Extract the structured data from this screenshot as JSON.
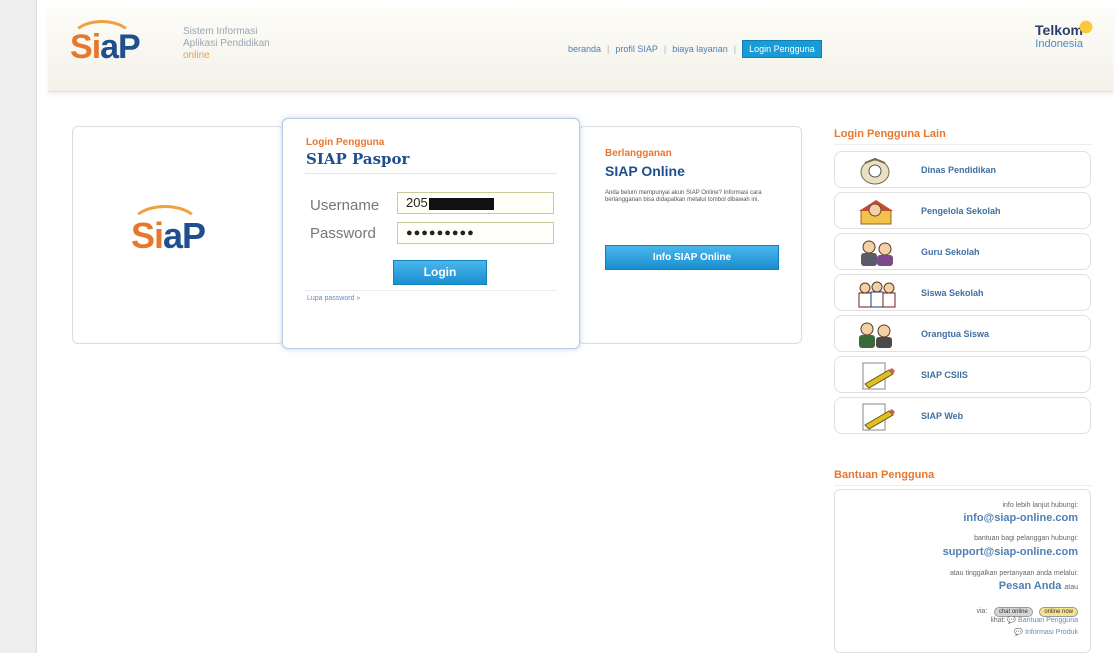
{
  "header": {
    "tagline": [
      "Sistem Informasi",
      "Aplikasi Pendidikan",
      "online"
    ],
    "nav": [
      "beranda",
      "profil SIAP",
      "biaya layanan",
      "Login Pengguna"
    ],
    "brand_name": "Telkom",
    "brand_sub": "Indonesia"
  },
  "logo": {
    "s": "S",
    "i": "i",
    "ap": "aP"
  },
  "login": {
    "small_title": "Login Pengguna",
    "big_title": "SIAP Paspor",
    "username_label": "Username",
    "username_value": "205",
    "password_label": "Password",
    "password_value": "●●●●●●●●●",
    "button": "Login",
    "forgot": "Lupa password »"
  },
  "online": {
    "small_title": "Berlangganan",
    "big_title": "SIAP Online",
    "description": "Anda belum mempunyai akun SIAP Online? Informasi cara berlangganan bisa didapatkan melalui tombol dibawah ini.",
    "button": "Info SIAP Online"
  },
  "sidebar": {
    "heading": "Login Pengguna Lain",
    "items": [
      {
        "label": "Dinas Pendidikan",
        "icon": "government-emblem-icon"
      },
      {
        "label": "Pengelola Sekolah",
        "icon": "school-manager-icon"
      },
      {
        "label": "Guru Sekolah",
        "icon": "teachers-icon"
      },
      {
        "label": "Siswa Sekolah",
        "icon": "students-icon"
      },
      {
        "label": "Orangtua Siswa",
        "icon": "parents-icon"
      },
      {
        "label": "SIAP CSIIS",
        "icon": "pencil-document-icon"
      },
      {
        "label": "SIAP Web",
        "icon": "pencil-document-icon"
      }
    ]
  },
  "help": {
    "heading": "Bantuan Pengguna",
    "info_text": "info lebih lanjut hubungi:",
    "info_email": "info@siap-online.com",
    "support_text": "bantuan bagi pelanggan hubungi:",
    "support_email": "support@siap-online.com",
    "message_text": "atau tinggalkan pertanyaan anda melalui:",
    "message_link": "Pesan Anda",
    "message_suffix": "atau",
    "via_label": "via:",
    "chat_offline": "chat online",
    "chat_online": "online now",
    "chat_prefix": "lihat:",
    "bantuan": "Bantuan Pengguna",
    "informasi": "Informasi Produk"
  },
  "colors": {
    "accent_orange": "#e8772e",
    "primary_blue": "#1f4f8c",
    "button_blue": "#1a8fd0",
    "link_blue": "#4f7fb5"
  }
}
